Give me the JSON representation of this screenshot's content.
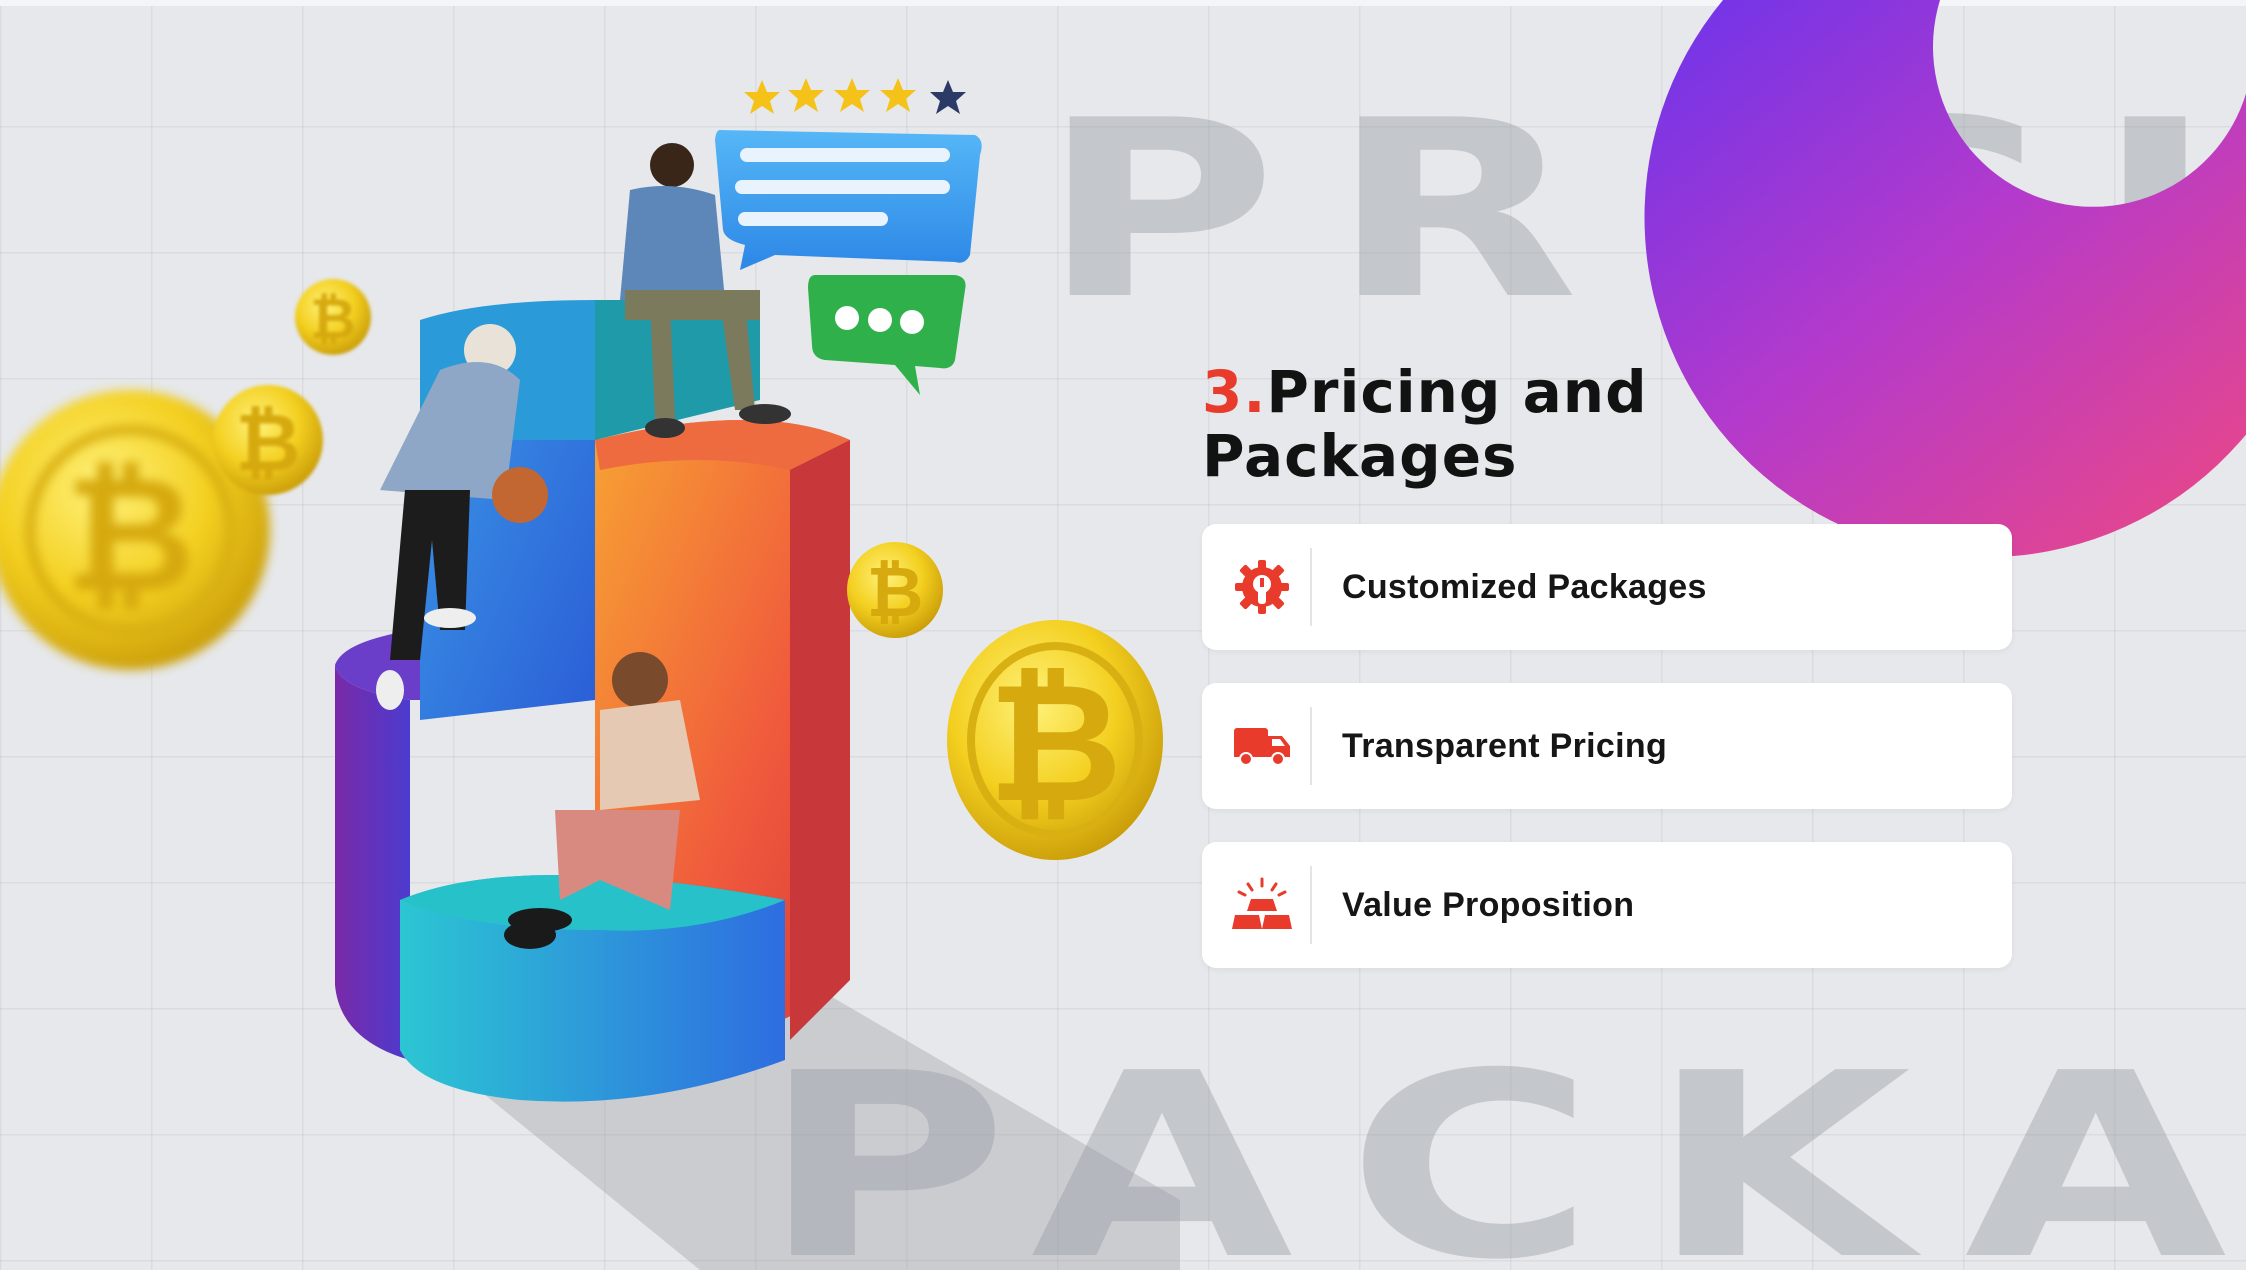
{
  "slide": {
    "title_number": "3.",
    "title_line1": "Pricing and",
    "title_line2": "Packages",
    "watermark_top": "PRICING",
    "watermark_bottom": "PACKAGE",
    "accent_color": "#e93b2c",
    "items": [
      {
        "label": "Customized Packages",
        "icon": "gear-wrench-icon"
      },
      {
        "label": "Transparent Pricing",
        "icon": "delivery-truck-icon"
      },
      {
        "label": "Value Proposition",
        "icon": "gold-bars-icon"
      }
    ],
    "rating": {
      "filled_stars": 4,
      "total_stars": 5
    },
    "illustration": {
      "coins_icon": "bitcoin-coin-icon",
      "chart_icon": "3d-pie-chart",
      "chat_icon": "chat-bubble-icon"
    }
  }
}
